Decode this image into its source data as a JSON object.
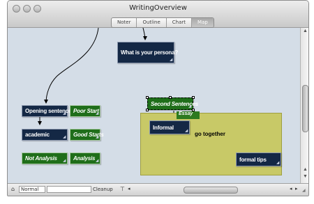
{
  "window": {
    "title": "WritingOverview"
  },
  "toolbar": {
    "tabs": [
      {
        "label": "Noter"
      },
      {
        "label": "Outline"
      },
      {
        "label": "Chart"
      },
      {
        "label": "Map",
        "active": true
      }
    ]
  },
  "map": {
    "nodes": {
      "persona": "What is your persona?",
      "opening": "Opening sentences",
      "poor_start": "Poor Start",
      "academic": "academic",
      "good_starts": "Good Starts",
      "not_analysis": "Not Analysis",
      "analysis": "Analysis",
      "second_sentences": "Second Sentences",
      "informal": "Informal",
      "formal_tips": "formal tips"
    },
    "region_label": "Essay",
    "link_label": "go together",
    "colors": {
      "node_navy": "#142845",
      "node_green": "#1f6e1a",
      "region": "#c8c967",
      "canvas": "#d4dde7"
    }
  },
  "bottombar": {
    "style_value": "Normal",
    "cleanup_label": "Cleanup"
  }
}
